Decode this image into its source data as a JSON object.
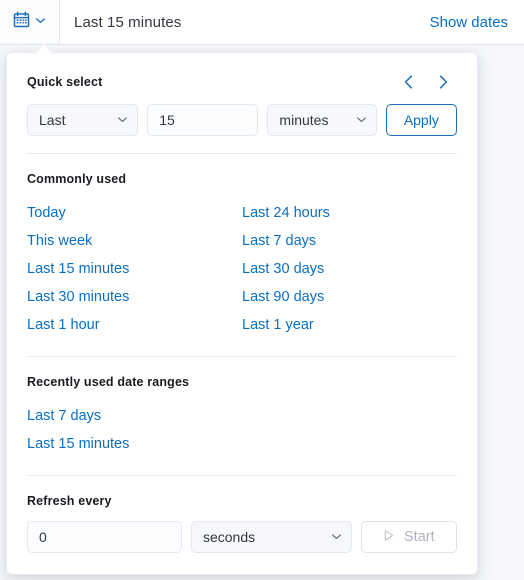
{
  "topbar": {
    "calendar_icon": "calendar-icon",
    "dropdown_icon": "chevron-down-icon",
    "range_label": "Last 15 minutes",
    "show_dates_label": "Show dates"
  },
  "quick_select": {
    "title": "Quick select",
    "prev_icon": "chevron-left-icon",
    "next_icon": "chevron-right-icon",
    "direction_value": "Last",
    "amount_value": "15",
    "unit_value": "minutes",
    "apply_label": "Apply"
  },
  "commonly_used": {
    "title": "Commonly used",
    "left_column": [
      "Today",
      "This week",
      "Last 15 minutes",
      "Last 30 minutes",
      "Last 1 hour"
    ],
    "right_column": [
      "Last 24 hours",
      "Last 7 days",
      "Last 30 days",
      "Last 90 days",
      "Last 1 year"
    ]
  },
  "recently_used": {
    "title": "Recently used date ranges",
    "items": [
      "Last 7 days",
      "Last 15 minutes"
    ]
  },
  "refresh": {
    "title": "Refresh every",
    "interval_value": "0",
    "unit_value": "seconds",
    "start_label": "Start",
    "start_icon": "play-icon",
    "start_disabled": true
  },
  "colors": {
    "link": "#0a6fc2",
    "accent": "#1c6fbb",
    "text": "#343741",
    "heading": "#1a1c21",
    "border": "#e6e8f0",
    "disabled": "#aeb3be",
    "panel_bg": "#ffffff",
    "page_bg": "#f5f7fa"
  }
}
